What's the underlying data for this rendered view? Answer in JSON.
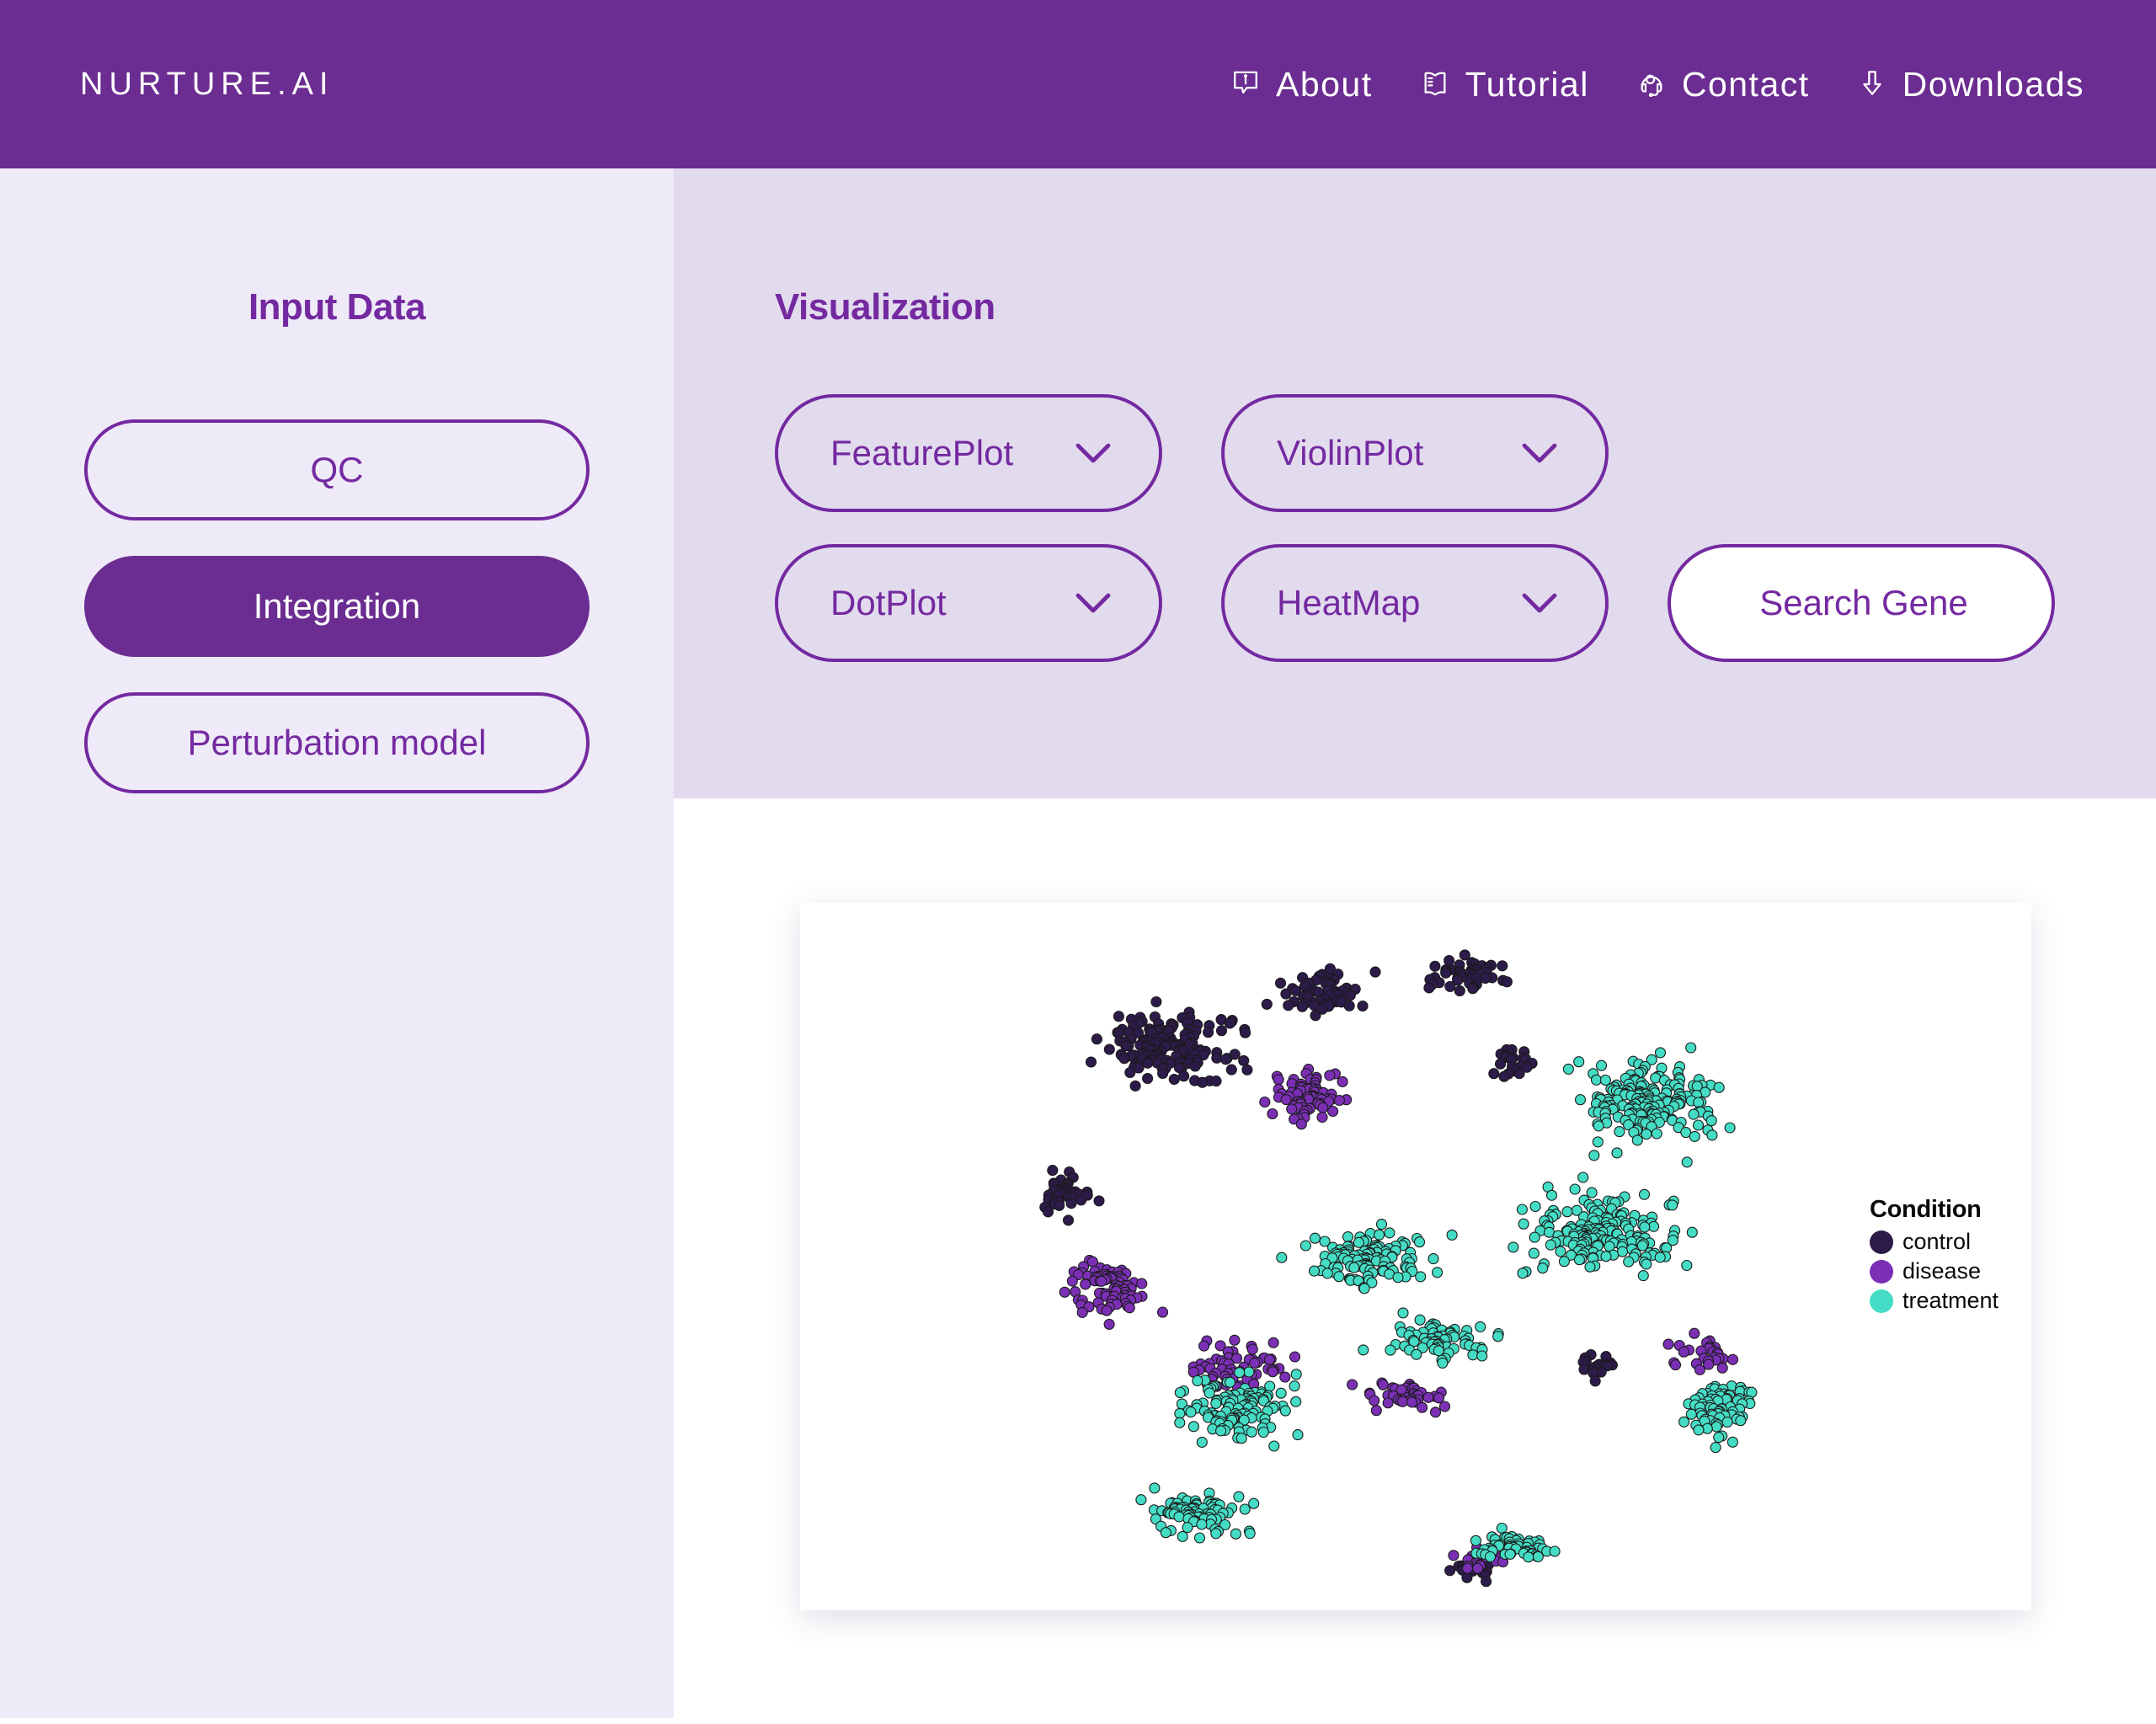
{
  "header": {
    "brand": "NURTURE.AI",
    "nav": [
      {
        "label": "About",
        "icon": "info-bubble-icon"
      },
      {
        "label": "Tutorial",
        "icon": "open-book-icon"
      },
      {
        "label": "Contact",
        "icon": "headset-support-icon"
      },
      {
        "label": "Downloads",
        "icon": "download-arrow-icon"
      }
    ]
  },
  "sidebar": {
    "title": "Input Data",
    "items": [
      {
        "label": "QC",
        "active": false
      },
      {
        "label": "Integration",
        "active": true
      },
      {
        "label": "Perturbation model",
        "active": false
      }
    ]
  },
  "visualization": {
    "title": "Visualization",
    "buttons": [
      {
        "label": "FeaturePlot",
        "type": "dropdown"
      },
      {
        "label": "ViolinPlot",
        "type": "dropdown"
      },
      {
        "label": "DotPlot",
        "type": "dropdown"
      },
      {
        "label": "HeatMap",
        "type": "dropdown"
      },
      {
        "label": "Search Gene",
        "type": "button"
      }
    ]
  },
  "colors": {
    "brand_purple": "#6b2d91",
    "accent_purple": "#7429a0",
    "sidebar_bg": "#eeeaf8",
    "viz_bg": "#e2dbee",
    "control": "#2d1b4a",
    "disease": "#7b2fb5",
    "treatment": "#44dcc4"
  },
  "chart_data": {
    "type": "scatter",
    "title": "",
    "xlabel": "",
    "ylabel": "",
    "grid": false,
    "axes_visible": false,
    "legend_position": "right",
    "legend_title": "Condition",
    "point_radius": 6,
    "point_stroke": "#1a1a1a",
    "series": [
      {
        "name": "control",
        "color": "#2d1b4a",
        "n": 320
      },
      {
        "name": "disease",
        "color": "#7b2fb5",
        "n": 300
      },
      {
        "name": "treatment",
        "color": "#44dcc4",
        "n": 820
      }
    ],
    "description": "UMAP embedding of single cells coloured by experimental condition. Control cells cluster in the upper-left arc, disease cells form a central-left band, and treatment cells dominate the right and lower regions of the manifold.",
    "blobs": [
      {
        "series": "control",
        "cx": 0.22,
        "cy": 0.18,
        "rx": 0.155,
        "ry": 0.105,
        "n": 150
      },
      {
        "series": "control",
        "cx": 0.4,
        "cy": 0.1,
        "rx": 0.12,
        "ry": 0.055,
        "n": 55
      },
      {
        "series": "control",
        "cx": 0.56,
        "cy": 0.07,
        "rx": 0.09,
        "ry": 0.05,
        "n": 48
      },
      {
        "series": "control",
        "cx": 0.1,
        "cy": 0.4,
        "rx": 0.065,
        "ry": 0.06,
        "n": 40
      },
      {
        "series": "control",
        "cx": 0.62,
        "cy": 0.2,
        "rx": 0.05,
        "ry": 0.07,
        "n": 22
      },
      {
        "series": "control",
        "cx": 0.72,
        "cy": 0.66,
        "rx": 0.055,
        "ry": 0.035,
        "n": 18
      },
      {
        "series": "control",
        "cx": 0.57,
        "cy": 0.96,
        "rx": 0.06,
        "ry": 0.035,
        "n": 24
      },
      {
        "series": "disease",
        "cx": 0.38,
        "cy": 0.25,
        "rx": 0.075,
        "ry": 0.08,
        "n": 70
      },
      {
        "series": "disease",
        "cx": 0.15,
        "cy": 0.54,
        "rx": 0.085,
        "ry": 0.09,
        "n": 80
      },
      {
        "series": "disease",
        "cx": 0.3,
        "cy": 0.66,
        "rx": 0.11,
        "ry": 0.07,
        "n": 60
      },
      {
        "series": "disease",
        "cx": 0.5,
        "cy": 0.7,
        "rx": 0.11,
        "ry": 0.045,
        "n": 40
      },
      {
        "series": "disease",
        "cx": 0.84,
        "cy": 0.64,
        "rx": 0.07,
        "ry": 0.055,
        "n": 28
      },
      {
        "series": "disease",
        "cx": 0.58,
        "cy": 0.95,
        "rx": 0.07,
        "ry": 0.035,
        "n": 22
      },
      {
        "series": "treatment",
        "cx": 0.78,
        "cy": 0.26,
        "rx": 0.15,
        "ry": 0.13,
        "n": 190
      },
      {
        "series": "treatment",
        "cx": 0.72,
        "cy": 0.46,
        "rx": 0.175,
        "ry": 0.11,
        "n": 180
      },
      {
        "series": "treatment",
        "cx": 0.45,
        "cy": 0.5,
        "rx": 0.135,
        "ry": 0.09,
        "n": 120
      },
      {
        "series": "treatment",
        "cx": 0.3,
        "cy": 0.72,
        "rx": 0.125,
        "ry": 0.09,
        "n": 120
      },
      {
        "series": "treatment",
        "cx": 0.25,
        "cy": 0.88,
        "rx": 0.105,
        "ry": 0.06,
        "n": 85
      },
      {
        "series": "treatment",
        "cx": 0.53,
        "cy": 0.62,
        "rx": 0.11,
        "ry": 0.06,
        "n": 70
      },
      {
        "series": "treatment",
        "cx": 0.86,
        "cy": 0.72,
        "rx": 0.08,
        "ry": 0.08,
        "n": 75
      },
      {
        "series": "treatment",
        "cx": 0.62,
        "cy": 0.93,
        "rx": 0.09,
        "ry": 0.04,
        "n": 55
      }
    ]
  }
}
